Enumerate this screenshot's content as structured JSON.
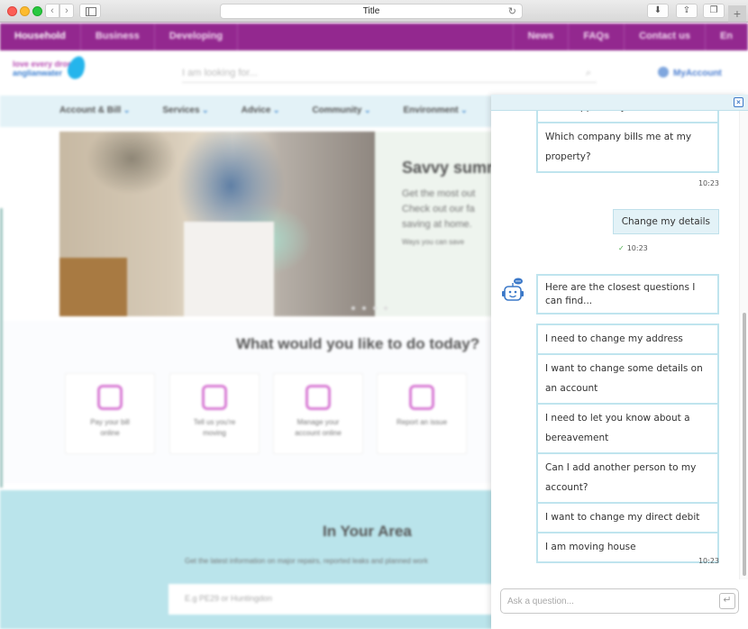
{
  "browser": {
    "title": "Title",
    "back_glyph": "‹",
    "forward_glyph": "›",
    "reload_glyph": "↻",
    "download_glyph": "⬇",
    "share_glyph": "⇪",
    "tabs_glyph": "❐",
    "newtab_glyph": "+"
  },
  "site": {
    "topnav": {
      "left": [
        "Household",
        "Business",
        "Developing"
      ],
      "right": [
        "News",
        "FAQs",
        "Contact us",
        "En"
      ]
    },
    "logo": {
      "line1": "love every drop",
      "line2": "anglianwater"
    },
    "search_placeholder": "I am looking for...",
    "search_icon_glyph": "⌕",
    "my_account_label": "MyAccount",
    "mainnav": [
      "Account & Bill",
      "Services",
      "Advice",
      "Community",
      "Environment"
    ],
    "hero": {
      "title": "Savvy summer",
      "text_lines": [
        "Get the most out",
        "Check out our fa",
        "saving at home."
      ],
      "link": "Ways you can save"
    },
    "tasks": {
      "title": "What would you like to do today?",
      "cards": [
        {
          "label": "Pay your bill online"
        },
        {
          "label": "Tell us you're moving"
        },
        {
          "label": "Manage your account online"
        },
        {
          "label": "Report an issue"
        }
      ]
    },
    "area": {
      "title": "In Your Area",
      "subtitle": "Get the latest information on major repairs, reported leaks and planned work",
      "input_placeholder": "E.g PE29 or Huntingdon"
    }
  },
  "chat": {
    "close_glyph": "×",
    "first_group": [
      {
        "text": "Who supplies my water?"
      },
      {
        "text": "Which company bills me at my property?"
      }
    ],
    "first_group_time": "10:23",
    "user_message": {
      "text": "Change my details",
      "time": "10:23",
      "status_glyph": "✓"
    },
    "bot_prompt": "Here are the closest questions I can find...",
    "suggestions": [
      {
        "text": "I need to change my address"
      },
      {
        "text": "I want to change some details on an account"
      },
      {
        "text": "I need to let you know about a bereavement"
      },
      {
        "text": "Can I add another person to my account?"
      },
      {
        "text": "I want to change my direct debit"
      },
      {
        "text": "I am moving house"
      }
    ],
    "suggestions_time": "10:23",
    "input_placeholder": "Ask a question...",
    "send_glyph": "↵",
    "colors": {
      "accent": "#3b78c8",
      "bubble_border": "#bfe4ee",
      "header_bg": "#e3f2f7",
      "check": "#4cae4c"
    }
  }
}
